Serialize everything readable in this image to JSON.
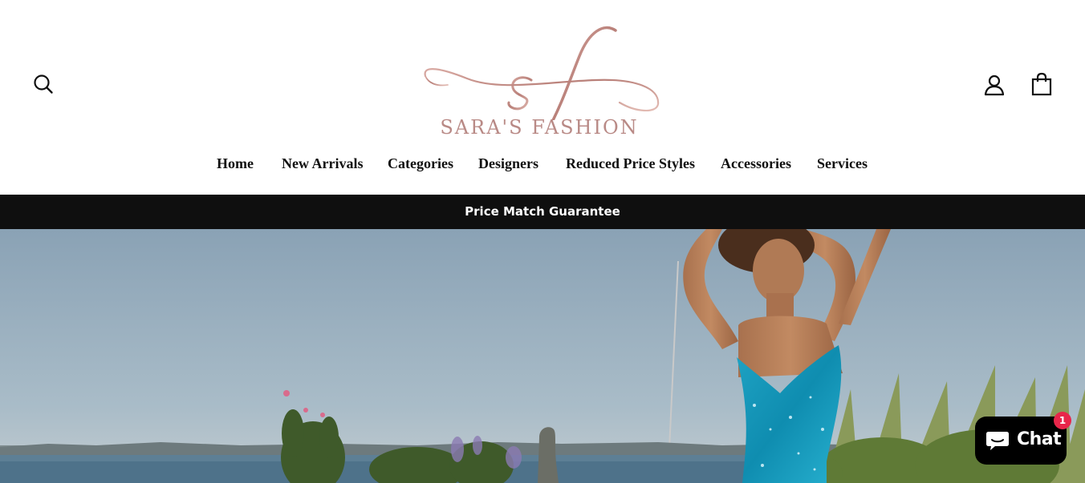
{
  "header": {
    "brand_name": "SARA'S FASHION",
    "logo_monogram": "sf",
    "brand_color": "#b98a86"
  },
  "nav": {
    "items": [
      {
        "label": "Home"
      },
      {
        "label": "New Arrivals"
      },
      {
        "label": "Categories"
      },
      {
        "label": "Designers"
      },
      {
        "label": "Reduced Price Styles"
      },
      {
        "label": "Accessories"
      },
      {
        "label": "Services"
      }
    ]
  },
  "icons": {
    "search": "search-icon",
    "account": "user-icon",
    "cart": "shopping-bag-icon",
    "chat": "chat-bubble-icon"
  },
  "announcement": {
    "text": "Price Match Guarantee",
    "background": "#0f0f0f"
  },
  "hero": {
    "image": "model in turquoise sequin gown by the water"
  },
  "chat": {
    "label": "Chat",
    "unread_count": "1",
    "badge_color": "#e8264a"
  }
}
